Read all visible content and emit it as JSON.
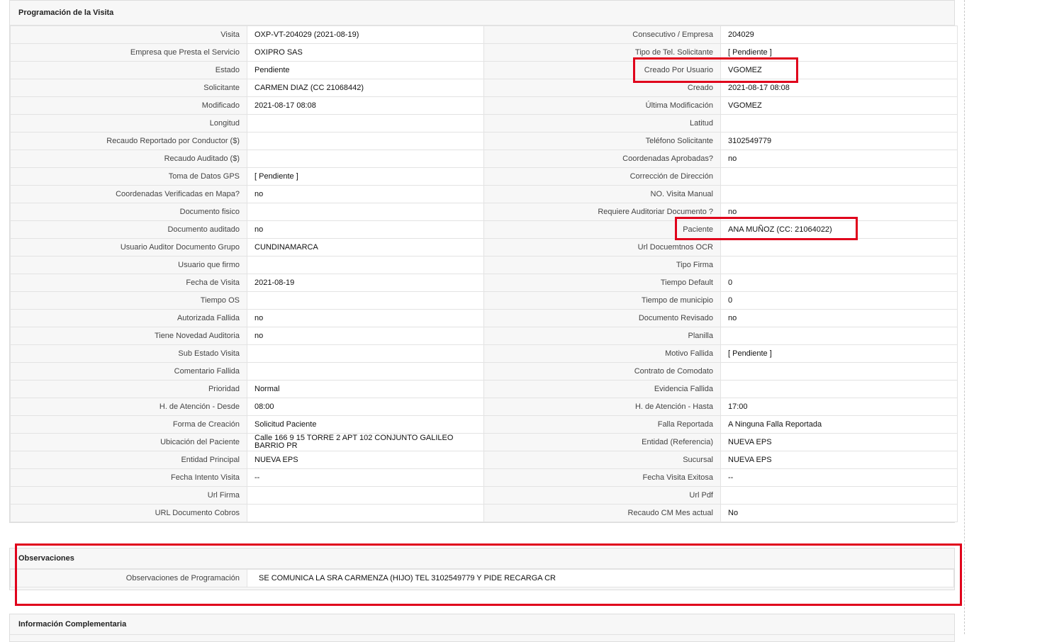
{
  "programacion": {
    "title": "Programación de la Visita",
    "rows": [
      {
        "l1": "Visita",
        "v1": "OXP-VT-204029 (2021-08-19)",
        "l2": "Consecutivo / Empresa",
        "v2": "204029"
      },
      {
        "l1": "Empresa que Presta el Servicio",
        "v1": "OXIPRO SAS",
        "l2": "Tipo de Tel. Solicitante",
        "v2": "[ Pendiente ]"
      },
      {
        "l1": "Estado",
        "v1": "Pendiente",
        "l2": "Creado Por Usuario",
        "v2": "VGOMEZ"
      },
      {
        "l1": "Solicitante",
        "v1": "CARMEN DIAZ (CC 21068442)",
        "l2": "Creado",
        "v2": "2021-08-17 08:08"
      },
      {
        "l1": "Modificado",
        "v1": "2021-08-17 08:08",
        "l2": "Última Modificación",
        "v2": " VGOMEZ"
      },
      {
        "l1": "Longitud",
        "v1": "",
        "l2": "Latitud",
        "v2": ""
      },
      {
        "l1": "Recaudo Reportado por Conductor ($)",
        "v1": "",
        "l2": "Teléfono Solicitante",
        "v2": "3102549779"
      },
      {
        "l1": "Recaudo Auditado ($)",
        "v1": "",
        "l2": "Coordenadas Aprobadas?",
        "v2": " no"
      },
      {
        "l1": "Toma de Datos GPS",
        "v1": "[ Pendiente ]",
        "l2": "Corrección de Dirección",
        "v2": ""
      },
      {
        "l1": "Coordenadas Verificadas en Mapa?",
        "v1": " no",
        "l2": "NO. Visita Manual",
        "v2": ""
      },
      {
        "l1": "Documento fisico",
        "v1": "",
        "l2": "Requiere Auditoriar Documento ?",
        "v2": " no"
      },
      {
        "l1": "Documento auditado",
        "v1": " no",
        "l2": "Paciente",
        "v2": "ANA MUÑOZ (CC: 21064022)"
      },
      {
        "l1": "Usuario Auditor Documento Grupo",
        "v1": "CUNDINAMARCA",
        "l2": "Url Docuemtnos OCR",
        "v2": ""
      },
      {
        "l1": "Usuario que firmo",
        "v1": "",
        "l2": "Tipo Firma",
        "v2": ""
      },
      {
        "l1": "Fecha de Visita",
        "v1": " 2021-08-19",
        "l2": "Tiempo Default",
        "v2": "0"
      },
      {
        "l1": "Tiempo OS",
        "v1": "",
        "l2": "Tiempo de municipio",
        "v2": "0"
      },
      {
        "l1": "Autorizada Fallida",
        "v1": " no",
        "l2": "Documento Revisado",
        "v2": " no"
      },
      {
        "l1": "Tiene Novedad Auditoria",
        "v1": " no",
        "l2": "Planilla",
        "v2": ""
      },
      {
        "l1": "Sub Estado Visita",
        "v1": "",
        "l2": "Motivo Fallida",
        "v2": "[ Pendiente ]"
      },
      {
        "l1": "Comentario Fallida",
        "v1": "",
        "l2": "Contrato de Comodato",
        "v2": ""
      },
      {
        "l1": "Prioridad",
        "v1": "Normal",
        "l2": "Evidencia Fallida",
        "v2": ""
      },
      {
        "l1": "H. de Atención - Desde",
        "v1": "08:00",
        "l2": "H. de Atención - Hasta",
        "v2": "17:00"
      },
      {
        "l1": "Forma de Creación",
        "v1": "Solicitud Paciente",
        "l2": "Falla Reportada",
        "v2": "A Ninguna Falla Reportada"
      },
      {
        "l1": "Ubicación del Paciente",
        "v1": "Calle 166 9 15 TORRE 2 APT 102 CONJUNTO GALILEO BARRIO PR",
        "l2": "Entidad (Referencia)",
        "v2": "NUEVA EPS"
      },
      {
        "l1": "Entidad Principal",
        "v1": "NUEVA EPS",
        "l2": "Sucursal",
        "v2": "NUEVA EPS"
      },
      {
        "l1": "Fecha Intento Visita",
        "v1": " --",
        "l2": "Fecha Visita Exitosa",
        "v2": " --"
      },
      {
        "l1": "Url Firma",
        "v1": "",
        "l2": "Url Pdf",
        "v2": ""
      },
      {
        "l1": "URL Documento Cobros",
        "v1": "",
        "l2": "Recaudo CM Mes actual",
        "v2": "No"
      }
    ]
  },
  "observaciones": {
    "title": "Observaciones",
    "label": "Observaciones de Programación",
    "value": "SE COMUNICA LA SRA CARMENZA (HIJO) TEL 3102549779 Y PIDE RECARGA CR"
  },
  "complementaria": {
    "title": "Información Complementaria"
  },
  "colors": {
    "highlight": "#e0001b",
    "label_bg": "#f7f7f7",
    "border": "#e3e3e3"
  }
}
